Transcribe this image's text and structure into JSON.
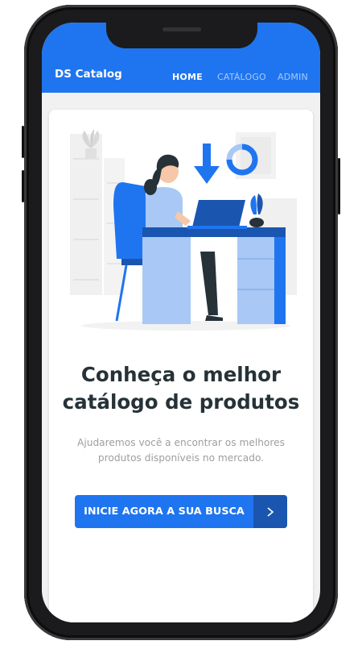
{
  "navbar": {
    "brand": "DS Catalog",
    "links": [
      {
        "label": "HOME",
        "active": true
      },
      {
        "label": "CATÁLOGO",
        "active": false
      },
      {
        "label": "ADMIN",
        "active": false
      }
    ]
  },
  "hero": {
    "title_line1": "Conheça o melhor",
    "title_line2": "catálogo de produtos",
    "subtitle_line1": "Ajudaremos você a encontrar os melhores",
    "subtitle_line2": "produtos disponíveis no mercado.",
    "cta_label": "INICIE AGORA A SUA BUSCA",
    "cta_icon": "chevron-right-icon"
  },
  "colors": {
    "primary": "#1f75f0",
    "primary_dark": "#1a56b0",
    "heading": "#263238",
    "muted": "#9e9e9e"
  }
}
